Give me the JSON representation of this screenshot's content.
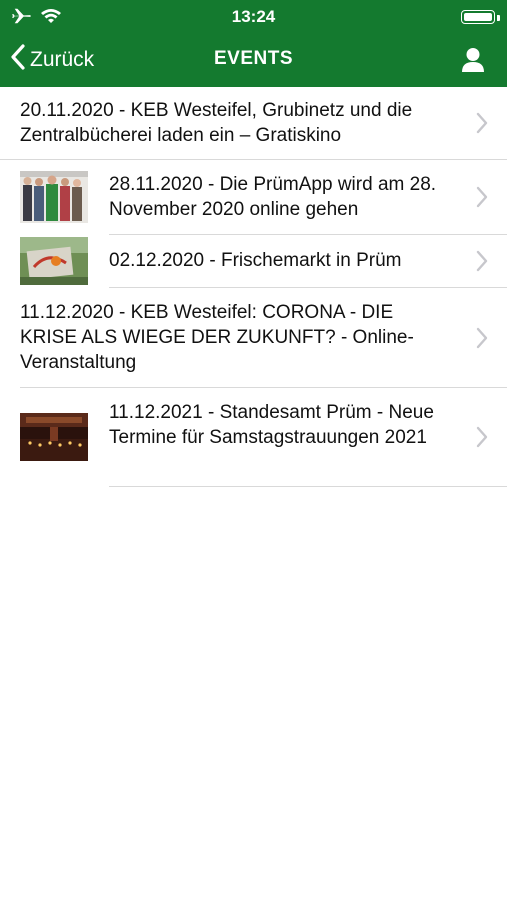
{
  "status_bar": {
    "time": "13:24",
    "icons": [
      "airplane-icon",
      "wifi-icon",
      "battery-icon"
    ]
  },
  "navbar": {
    "back_label": "Zurück",
    "title": "EVENTS",
    "icons": [
      "chevron-left-icon",
      "user-icon"
    ]
  },
  "colors": {
    "header_green": "#147a2f",
    "separator": "#d9d9d9",
    "chevron": "#c7c7cc"
  },
  "events": [
    {
      "text": "20.11.2020 - KEB Westeifel, Grubinetz und die Zentralbücherei laden ein – Gratiskino",
      "has_thumbnail": false
    },
    {
      "text": "28.11.2020 - Die PrümApp wird am 28. November 2020 online gehen",
      "has_thumbnail": true
    },
    {
      "text": "02.12.2020 - Frischemarkt in Prüm",
      "has_thumbnail": true
    },
    {
      "text": "11.12.2020 - KEB Westeifel: CORONA - DIE KRISE ALS WIEGE DER ZUKUNFT? - Online-Veranstaltung",
      "has_thumbnail": false
    },
    {
      "text": "11.12.2021 - Standesamt Prüm - Neue Termine für Samstagstrauungen 2021",
      "has_thumbnail": true
    }
  ]
}
